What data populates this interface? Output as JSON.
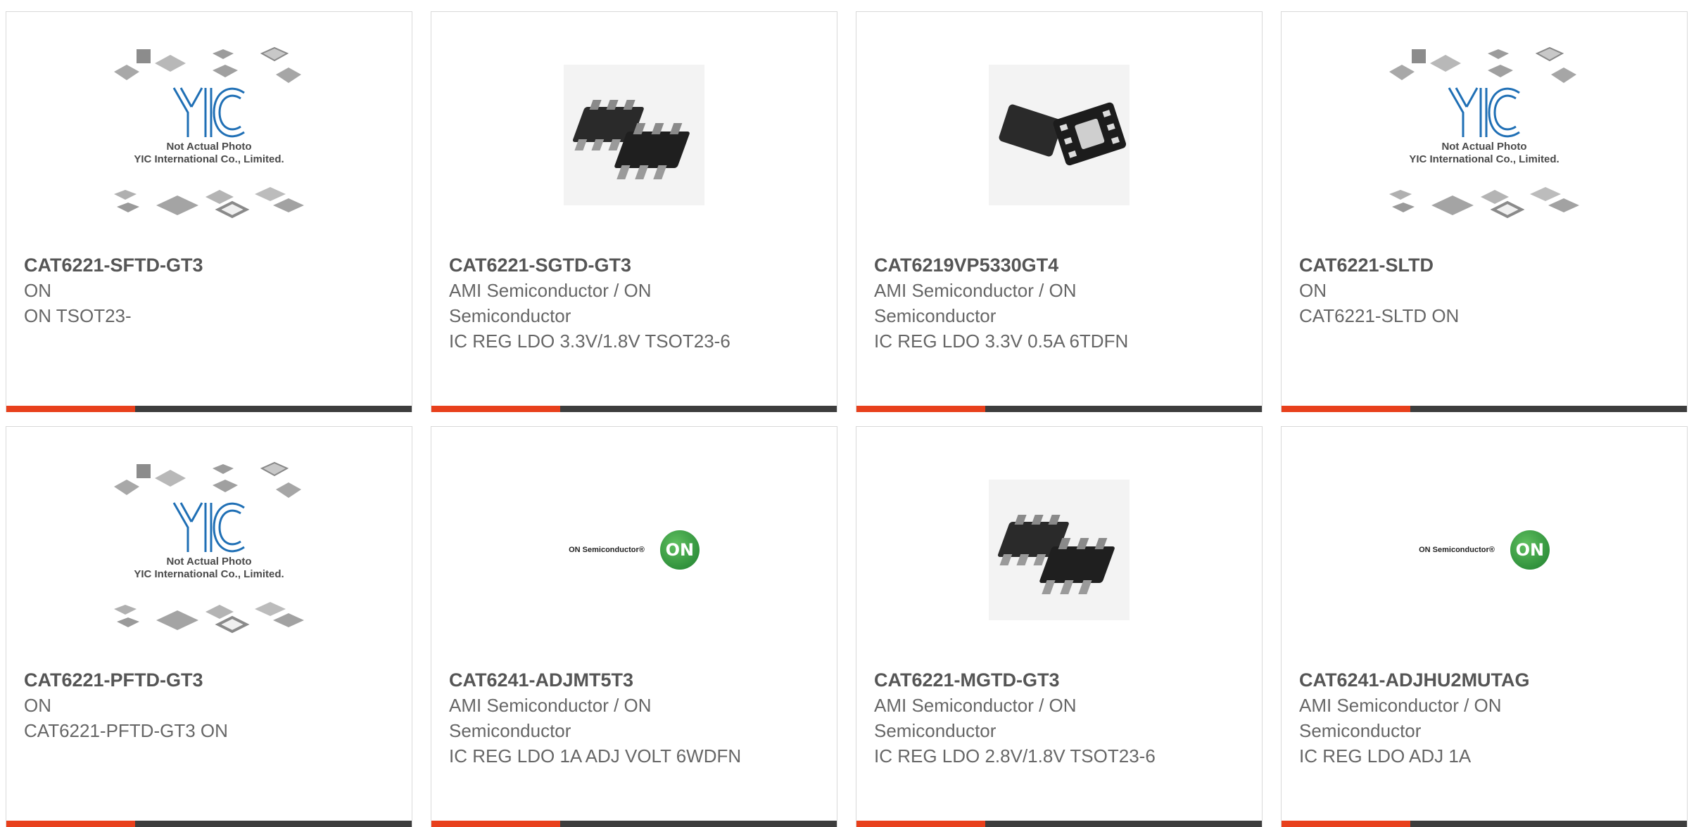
{
  "colors": {
    "accent": "#e8401c",
    "bar": "#3d3d3d",
    "text": "#666666"
  },
  "products": [
    {
      "part": "CAT6221-SFTD-GT3",
      "mfr": "ON",
      "desc": "ON TSOT23-",
      "image": "not-actual-photo",
      "caption1": "Not Actual Photo",
      "caption2": "YIC International Co., Limited."
    },
    {
      "part": "CAT6221-SGTD-GT3",
      "mfr": "AMI Semiconductor / ON Semiconductor",
      "desc": "IC REG LDO 3.3V/1.8V TSOT23-6",
      "image": "sot23-6-chips"
    },
    {
      "part": "CAT6219VP5330GT4",
      "mfr": "AMI Semiconductor / ON Semiconductor",
      "desc": "IC REG LDO 3.3V 0.5A 6TDFN",
      "image": "tdfn-chips"
    },
    {
      "part": "CAT6221-SLTD",
      "mfr": "ON",
      "desc": "CAT6221-SLTD ON",
      "image": "not-actual-photo",
      "caption1": "Not Actual Photo",
      "caption2": "YIC International Co., Limited."
    },
    {
      "part": "CAT6221-PFTD-GT3",
      "mfr": "ON",
      "desc": "CAT6221-PFTD-GT3 ON",
      "image": "not-actual-photo",
      "caption1": "Not Actual Photo",
      "caption2": "YIC International Co., Limited."
    },
    {
      "part": "CAT6241-ADJMT5T3",
      "mfr": "AMI Semiconductor / ON Semiconductor",
      "desc": "IC REG LDO 1A ADJ VOLT 6WDFN",
      "image": "on-semi-logo",
      "logo_text": "ON Semiconductor®",
      "logo_mark": "ON"
    },
    {
      "part": "CAT6221-MGTD-GT3",
      "mfr": "AMI Semiconductor / ON Semiconductor",
      "desc": "IC REG LDO 2.8V/1.8V TSOT23-6",
      "image": "sot23-6-chips"
    },
    {
      "part": "CAT6241-ADJHU2MUTAG",
      "mfr": "AMI Semiconductor / ON Semiconductor",
      "desc": "IC REG LDO ADJ 1A",
      "image": "on-semi-logo",
      "logo_text": "ON Semiconductor®",
      "logo_mark": "ON"
    }
  ]
}
